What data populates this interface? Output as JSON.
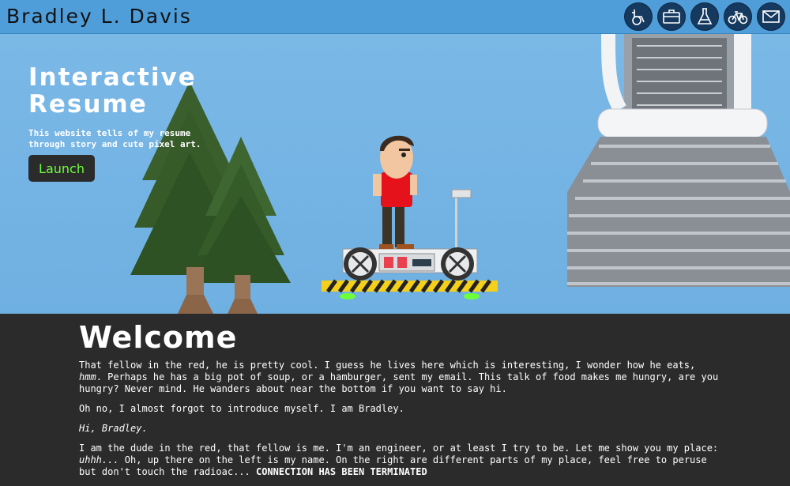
{
  "site": {
    "title": "Bradley L. Davis"
  },
  "nav": [
    {
      "name": "wheelchair-icon"
    },
    {
      "name": "briefcase-icon"
    },
    {
      "name": "flask-icon"
    },
    {
      "name": "bicycle-icon"
    },
    {
      "name": "mail-icon"
    }
  ],
  "hero": {
    "title_line1": "Interactive",
    "title_line2": "Resume",
    "desc_line1": "This website tells of my resume",
    "desc_line2": "through story and cute pixel art.",
    "launch_label": "Launch"
  },
  "welcome": {
    "heading": "Welcome",
    "p1_a": "That fellow in the red, he is pretty cool. I guess he lives here which is interesting, I wonder how he eats, ",
    "p1_em": "hmm",
    "p1_b": ". Perhaps he has a big pot of soup, or a hamburger, sent my email. This talk of food makes me hungry, are you hungry? Never mind. He wanders about near the bottom if you want to say hi.",
    "p2": "Oh no, I almost forgot to introduce myself. I am Bradley.",
    "p3": "Hi, Bradley.",
    "p4_a": "I am the dude in the red, that fellow is me. I'm an engineer, or at least I try to be. Let me show you my place: ",
    "p4_em": "uhhh...",
    "p4_b": " Oh, up there on the left is my name. On the right are different parts of my place, feel free to peruse but don't touch the radioac... ",
    "p4_strong": "CONNECTION HAS BEEN TERMINATED"
  },
  "colors": {
    "topbar": "#4f9ed9",
    "sky": "#72b3e3",
    "nav_circle": "#15395f",
    "launch_text": "#6dff3a",
    "panel": "#2b2b2b"
  }
}
